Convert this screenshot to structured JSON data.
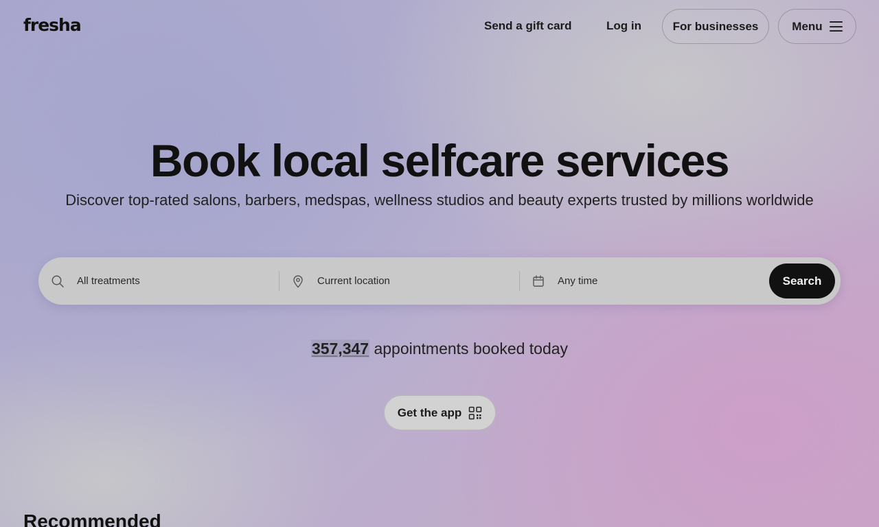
{
  "header": {
    "logo": "fresha",
    "gift_card": "Send a gift card",
    "login": "Log in",
    "for_businesses": "For businesses",
    "menu": "Menu"
  },
  "hero": {
    "title": "Book local selfcare services",
    "subtitle": "Discover top-rated salons, barbers, medspas, wellness studios and beauty experts trusted by millions worldwide"
  },
  "search": {
    "treatments": "All treatments",
    "location": "Current location",
    "time": "Any time",
    "button": "Search"
  },
  "stats": {
    "count": "357,347",
    "suffix": " appointments booked today"
  },
  "app_button": "Get the app",
  "sections": {
    "recommended": "Recommended"
  },
  "icons": {
    "search": "search-icon",
    "location": "location-pin-icon",
    "calendar": "calendar-icon",
    "menu": "hamburger-icon",
    "qr": "qr-code-icon"
  }
}
